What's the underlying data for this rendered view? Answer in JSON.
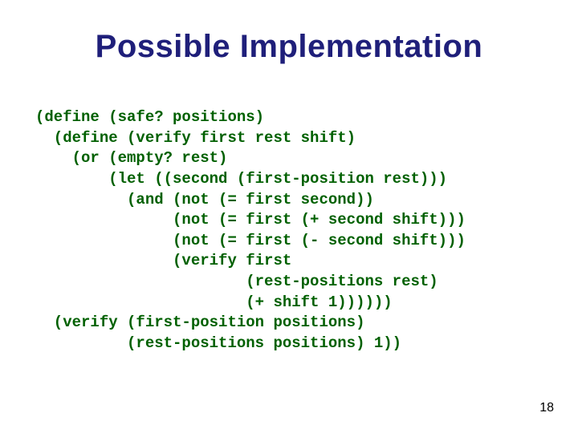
{
  "title": "Possible Implementation",
  "code_lines": [
    "(define (safe? positions)",
    "  (define (verify first rest shift)",
    "    (or (empty? rest)",
    "        (let ((second (first-position rest)))",
    "          (and (not (= first second))",
    "               (not (= first (+ second shift)))",
    "               (not (= first (- second shift)))",
    "               (verify first",
    "                       (rest-positions rest)",
    "                       (+ shift 1))))))",
    "  (verify (first-position positions)",
    "          (rest-positions positions) 1))"
  ],
  "page_number": "18"
}
